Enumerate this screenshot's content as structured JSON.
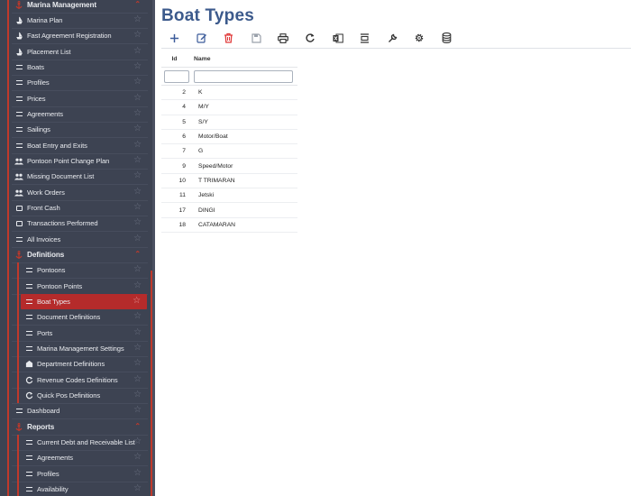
{
  "page": {
    "title": "Boat Types"
  },
  "colors": {
    "sidebar_bg": "#3d4352",
    "active_bg": "#b52b2b",
    "accent_red": "#c0392b",
    "title_blue": "#3c5a8c"
  },
  "sidebar": {
    "marina_management": "Marina Management",
    "items_top": [
      {
        "label": "Marina Plan",
        "icon": "boat-icon"
      },
      {
        "label": "Fast Agreement Registration",
        "icon": "boat-icon"
      },
      {
        "label": "Placement List",
        "icon": "boat-icon"
      },
      {
        "label": "Boats",
        "icon": "list-icon"
      },
      {
        "label": "Profiles",
        "icon": "list-icon"
      },
      {
        "label": "Prices",
        "icon": "list-icon"
      },
      {
        "label": "Agreements",
        "icon": "list-icon"
      },
      {
        "label": "Sailings",
        "icon": "list-icon"
      },
      {
        "label": "Boat Entry and Exits",
        "icon": "list-icon"
      },
      {
        "label": "Pontoon Point Change Plan",
        "icon": "people-icon"
      },
      {
        "label": "Missing Document List",
        "icon": "people-icon"
      },
      {
        "label": "Work Orders",
        "icon": "people-icon"
      },
      {
        "label": "Front Cash",
        "icon": "cash-icon"
      },
      {
        "label": "Transactions Performed",
        "icon": "cash-icon"
      },
      {
        "label": "All Invoices",
        "icon": "list-icon"
      }
    ],
    "definitions": "Definitions",
    "definition_items": [
      {
        "label": "Pontoons",
        "icon": "list-icon"
      },
      {
        "label": "Pontoon Points",
        "icon": "list-icon"
      },
      {
        "label": "Boat Types",
        "icon": "list-icon"
      },
      {
        "label": "Document Definitions",
        "icon": "list-icon"
      },
      {
        "label": "Ports",
        "icon": "list-icon"
      },
      {
        "label": "Marina Management Settings",
        "icon": "list-icon"
      },
      {
        "label": "Department Definitions",
        "icon": "building-icon"
      },
      {
        "label": "Revenue Codes Definitions",
        "icon": "refresh-icon"
      },
      {
        "label": "Quick Pos Definitions",
        "icon": "refresh-icon"
      }
    ],
    "dashboard": "Dashboard",
    "reports": "Reports",
    "report_items": [
      {
        "label": "Current Debt and Receivable List",
        "icon": "list-icon"
      },
      {
        "label": "Agreements",
        "icon": "list-icon"
      },
      {
        "label": "Profiles",
        "icon": "list-icon"
      },
      {
        "label": "Availability",
        "icon": "list-icon"
      }
    ]
  },
  "toolbar": {
    "buttons": [
      {
        "name": "add-icon"
      },
      {
        "name": "edit-icon"
      },
      {
        "name": "delete-icon"
      },
      {
        "name": "save-icon"
      },
      {
        "name": "print-icon"
      },
      {
        "name": "refresh-icon"
      },
      {
        "name": "excel-icon"
      },
      {
        "name": "fit-icon"
      },
      {
        "name": "wrench-icon"
      },
      {
        "name": "gear-icon"
      },
      {
        "name": "database-icon"
      }
    ]
  },
  "grid": {
    "columns": {
      "id": "Id",
      "name": "Name"
    },
    "rows": [
      {
        "id": "2",
        "name": "K"
      },
      {
        "id": "4",
        "name": "M/Y"
      },
      {
        "id": "5",
        "name": "S/Y"
      },
      {
        "id": "6",
        "name": "Motor/Boat"
      },
      {
        "id": "7",
        "name": "G"
      },
      {
        "id": "9",
        "name": "Speed/Motor"
      },
      {
        "id": "10",
        "name": "T TRIMARAN"
      },
      {
        "id": "11",
        "name": "Jetski"
      },
      {
        "id": "17",
        "name": "DINGI"
      },
      {
        "id": "18",
        "name": "CATAMARAN"
      }
    ]
  }
}
